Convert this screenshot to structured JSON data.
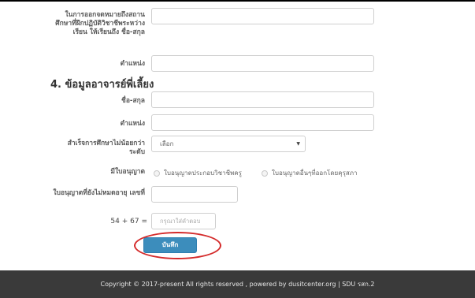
{
  "form": {
    "rows": [
      {
        "label": "ในการออกจดหมายถึงสถานศึกษาที่ฝึกปฏิบัติวิชาชีพระหว่างเรียน ให้เรียนถึง ชื่อ-สกุล",
        "value": ""
      },
      {
        "label": "ตำแหน่ง",
        "value": ""
      }
    ],
    "section4_title": "4. ข้อมูลอาจารย์พี่เลี้ยง",
    "mentor_rows": [
      {
        "label": "ชื่อ-สกุล",
        "value": ""
      },
      {
        "label": "ตำแหน่ง",
        "value": ""
      }
    ],
    "education_label": "สำเร็จการศึกษาไม่น้อยกว่าระดับ",
    "education_select": "เลือก",
    "license_label": "มีใบอนุญาต",
    "license_options": [
      "ใบอนุญาตประกอบวิชาชีพครู",
      "ใบอนุญาตอื่นๆที่ออกโดยคุรุสภา"
    ],
    "license_number_label": "ใบอนุญาตที่ยังไม่หมดอายุ เลขที่",
    "license_number_value": "",
    "captcha_question": "54 + 67 =",
    "captcha_placeholder": "กรุณาใส่คำตอบ",
    "submit_label": "บันทึก"
  },
  "footer": {
    "text": "Copyright © 2017-present All rights reserved , powered by dusitcenter.org | SDU รสก.2"
  },
  "colors": {
    "primary_button": "#3c8dbc",
    "highlight_circle": "#d42a2a",
    "footer_bg": "#3a3a3a"
  }
}
